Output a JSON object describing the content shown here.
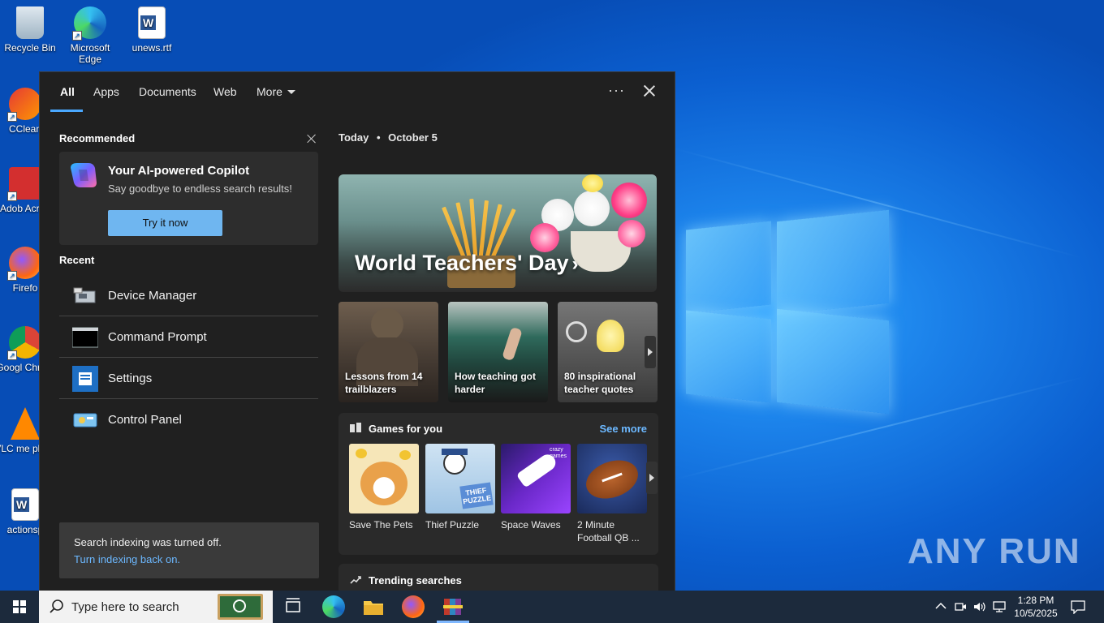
{
  "desktop": {
    "icons": [
      {
        "label": "Recycle Bin",
        "icon": "recycle-bin-icon"
      },
      {
        "label": "Microsoft Edge",
        "icon": "edge-icon"
      },
      {
        "label": "unews.rtf",
        "icon": "word-document-icon"
      },
      {
        "label": "CClean",
        "icon": "ccleaner-icon"
      },
      {
        "label": "Adob Acrob",
        "icon": "acrobat-icon"
      },
      {
        "label": "Firefo",
        "icon": "firefox-icon"
      },
      {
        "label": "Googl Chrom",
        "icon": "chrome-icon"
      },
      {
        "label": "VLC me playe",
        "icon": "vlc-icon"
      },
      {
        "label": "actionsp",
        "icon": "word-document-icon"
      }
    ],
    "watermark": "ANY RUN"
  },
  "search_panel": {
    "tabs": [
      {
        "label": "All",
        "active": true
      },
      {
        "label": "Apps"
      },
      {
        "label": "Documents"
      },
      {
        "label": "Web"
      },
      {
        "label": "More"
      }
    ],
    "more_options": "···",
    "recommended": {
      "heading": "Recommended",
      "copilot_title": "Your AI-powered Copilot",
      "copilot_subtitle": "Say goodbye to endless search results!",
      "button": "Try it now"
    },
    "recent": {
      "heading": "Recent",
      "items": [
        {
          "label": "Device Manager",
          "icon": "device-manager-icon"
        },
        {
          "label": "Command Prompt",
          "icon": "command-prompt-icon"
        },
        {
          "label": "Settings",
          "icon": "settings-icon"
        },
        {
          "label": "Control Panel",
          "icon": "control-panel-icon"
        }
      ]
    },
    "indexing": {
      "message": "Search indexing was turned off.",
      "link": "Turn indexing back on."
    },
    "today": {
      "label": "Today",
      "separator": "•",
      "date": "October 5"
    },
    "hero": {
      "title": "World Teachers' Day",
      "chevron": "›"
    },
    "cards": [
      {
        "text": "Lessons from 14 trailblazers"
      },
      {
        "text": "How teaching got harder"
      },
      {
        "text": "80 inspirational teacher quotes"
      }
    ],
    "games": {
      "heading": "Games for you",
      "see_more": "See more",
      "items": [
        {
          "name": "Save The Pets"
        },
        {
          "name": "Thief Puzzle"
        },
        {
          "name": "Space Waves"
        },
        {
          "name": "2 Minute Football QB ..."
        }
      ],
      "thumb_labels": {
        "thief": "THIEF PUZZLE",
        "space": "crazy games"
      }
    },
    "trending": {
      "heading": "Trending searches"
    }
  },
  "taskbar": {
    "search_placeholder": "Type here to search",
    "time": "1:28 PM",
    "date": "10/5/2025"
  }
}
